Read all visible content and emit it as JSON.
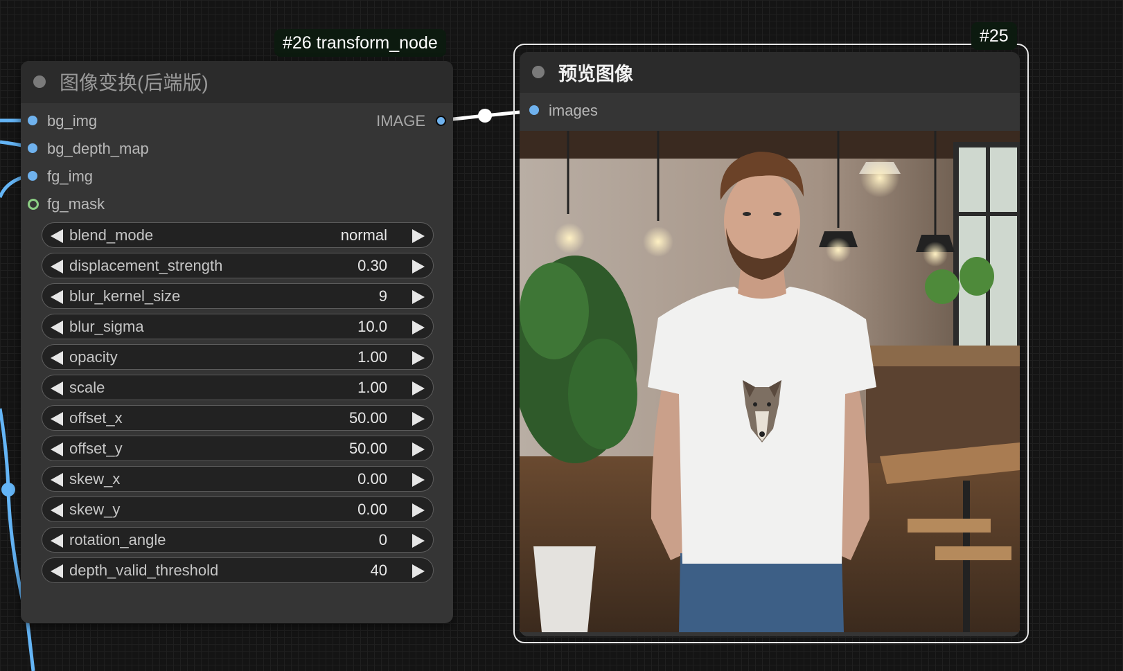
{
  "canvas": {
    "bg_color": "#141414",
    "link_color": "#64b5f6"
  },
  "transform_node": {
    "id_badge": "#26 transform_node",
    "title": "图像变换(后端版)",
    "inputs": [
      {
        "name": "bg_img",
        "type_color": "#6fb2ee"
      },
      {
        "name": "bg_depth_map",
        "type_color": "#6fb2ee"
      },
      {
        "name": "fg_img",
        "type_color": "#6fb2ee"
      },
      {
        "name": "fg_mask",
        "type_color": "#8ccf84"
      }
    ],
    "output": {
      "name": "IMAGE",
      "type_color": "#6fb2ee"
    },
    "widgets": [
      {
        "name": "blend_mode",
        "value": "normal"
      },
      {
        "name": "displacement_strength",
        "value": "0.30"
      },
      {
        "name": "blur_kernel_size",
        "value": "9"
      },
      {
        "name": "blur_sigma",
        "value": "10.0"
      },
      {
        "name": "opacity",
        "value": "1.00"
      },
      {
        "name": "scale",
        "value": "1.00"
      },
      {
        "name": "offset_x",
        "value": "50.00"
      },
      {
        "name": "offset_y",
        "value": "50.00"
      },
      {
        "name": "skew_x",
        "value": "0.00"
      },
      {
        "name": "skew_y",
        "value": "0.00"
      },
      {
        "name": "rotation_angle",
        "value": "0"
      },
      {
        "name": "depth_valid_threshold",
        "value": "40"
      }
    ]
  },
  "preview_node": {
    "id_badge": "#25",
    "title": "预览图像",
    "inputs": [
      {
        "name": "images",
        "type_color": "#6fb2ee"
      }
    ]
  }
}
